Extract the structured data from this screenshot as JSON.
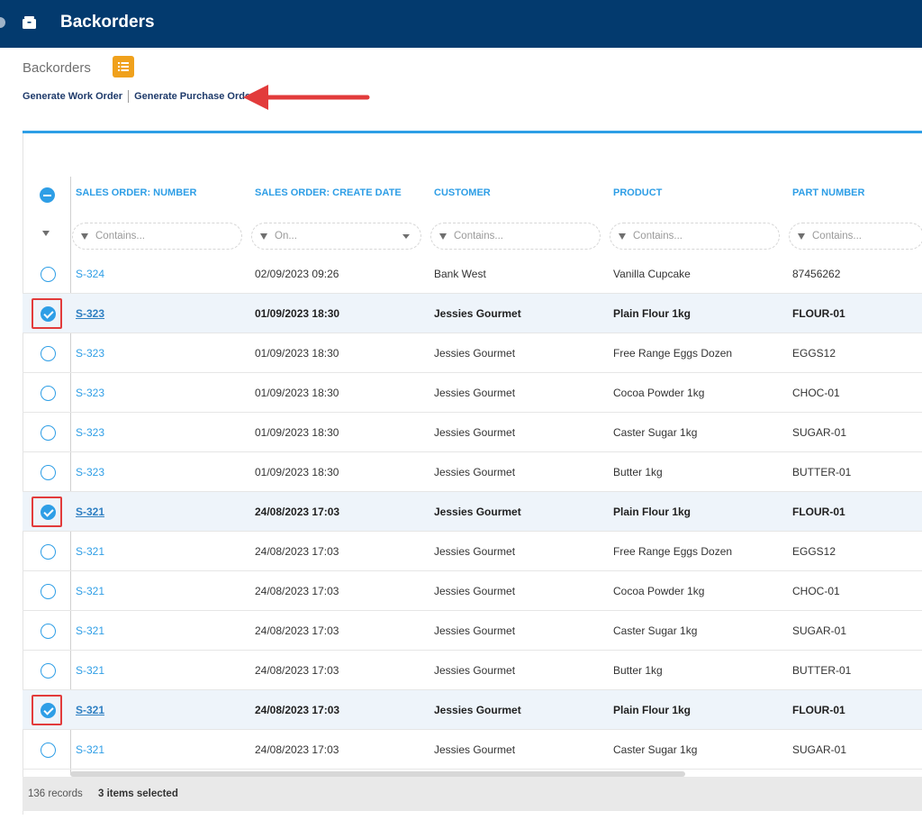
{
  "topbar": {
    "title": "Backorders",
    "icon": "box-icon",
    "bg": "#033a6e"
  },
  "page": {
    "title": "Backorders",
    "list_icon": "list-icon"
  },
  "actions": {
    "work_order": "Generate Work Order",
    "purchase_order": "Generate Purchase Order"
  },
  "columns": {
    "so_number": "SALES ORDER: NUMBER",
    "create_date": "SALES ORDER: CREATE DATE",
    "customer": "CUSTOMER",
    "product": "PRODUCT",
    "part_number": "PART NUMBER"
  },
  "filters": {
    "so_number": "Contains...",
    "create_date": "On...",
    "customer": "Contains...",
    "product": "Contains...",
    "part_number": "Contains..."
  },
  "rows": [
    {
      "so": "S-324",
      "date": "02/09/2023 09:26",
      "customer": "Bank West",
      "product": "Vanilla Cupcake",
      "part": "87456262",
      "selected": false
    },
    {
      "so": "S-323",
      "date": "01/09/2023 18:30",
      "customer": "Jessies Gourmet",
      "product": "Plain Flour 1kg",
      "part": "FLOUR-01",
      "selected": true
    },
    {
      "so": "S-323",
      "date": "01/09/2023 18:30",
      "customer": "Jessies Gourmet",
      "product": "Free Range Eggs Dozen",
      "part": "EGGS12",
      "selected": false
    },
    {
      "so": "S-323",
      "date": "01/09/2023 18:30",
      "customer": "Jessies Gourmet",
      "product": "Cocoa Powder 1kg",
      "part": "CHOC-01",
      "selected": false
    },
    {
      "so": "S-323",
      "date": "01/09/2023 18:30",
      "customer": "Jessies Gourmet",
      "product": "Caster Sugar 1kg",
      "part": "SUGAR-01",
      "selected": false
    },
    {
      "so": "S-323",
      "date": "01/09/2023 18:30",
      "customer": "Jessies Gourmet",
      "product": "Butter 1kg",
      "part": "BUTTER-01",
      "selected": false
    },
    {
      "so": "S-321",
      "date": "24/08/2023 17:03",
      "customer": "Jessies Gourmet",
      "product": "Plain Flour 1kg",
      "part": "FLOUR-01",
      "selected": true
    },
    {
      "so": "S-321",
      "date": "24/08/2023 17:03",
      "customer": "Jessies Gourmet",
      "product": "Free Range Eggs Dozen",
      "part": "EGGS12",
      "selected": false
    },
    {
      "so": "S-321",
      "date": "24/08/2023 17:03",
      "customer": "Jessies Gourmet",
      "product": "Cocoa Powder 1kg",
      "part": "CHOC-01",
      "selected": false
    },
    {
      "so": "S-321",
      "date": "24/08/2023 17:03",
      "customer": "Jessies Gourmet",
      "product": "Caster Sugar 1kg",
      "part": "SUGAR-01",
      "selected": false
    },
    {
      "so": "S-321",
      "date": "24/08/2023 17:03",
      "customer": "Jessies Gourmet",
      "product": "Butter 1kg",
      "part": "BUTTER-01",
      "selected": false
    },
    {
      "so": "S-321",
      "date": "24/08/2023 17:03",
      "customer": "Jessies Gourmet",
      "product": "Plain Flour 1kg",
      "part": "FLOUR-01",
      "selected": true
    },
    {
      "so": "S-321",
      "date": "24/08/2023 17:03",
      "customer": "Jessies Gourmet",
      "product": "Caster Sugar 1kg",
      "part": "SUGAR-01",
      "selected": false
    }
  ],
  "footer": {
    "records": "136 records",
    "selected": "3 items selected"
  },
  "colors": {
    "accent": "#2e9ee6",
    "highlight": "#e23b3b",
    "list_button": "#f0a11c"
  }
}
